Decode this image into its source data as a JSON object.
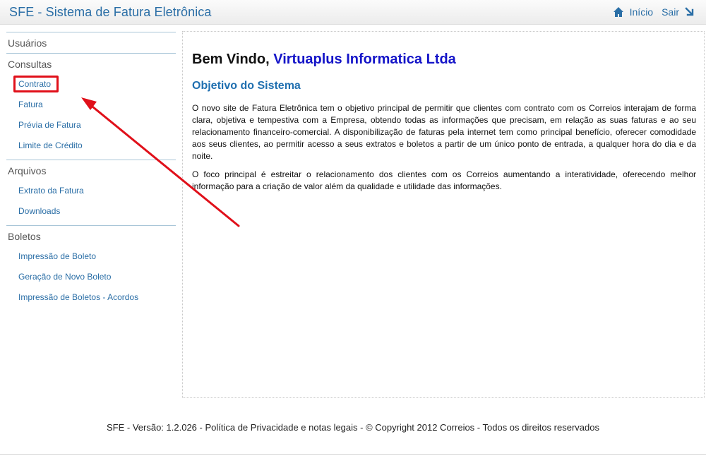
{
  "header": {
    "title": "SFE - Sistema de Fatura Eletrônica",
    "home_label": "Início",
    "exit_label": "Sair"
  },
  "sidebar": {
    "groups": [
      {
        "heading": "Usuários",
        "items": []
      },
      {
        "heading": "Consultas",
        "items": [
          {
            "label": "Contrato",
            "highlighted": true
          },
          {
            "label": "Fatura"
          },
          {
            "label": "Prévia de Fatura"
          },
          {
            "label": "Limite de Crédito"
          }
        ]
      },
      {
        "heading": "Arquivos",
        "items": [
          {
            "label": "Extrato da Fatura"
          },
          {
            "label": "Downloads"
          }
        ]
      },
      {
        "heading": "Boletos",
        "items": [
          {
            "label": "Impressão de Boleto"
          },
          {
            "label": "Geração de Novo Boleto"
          },
          {
            "label": "Impressão de Boletos - Acordos"
          }
        ]
      }
    ]
  },
  "main": {
    "welcome_prefix": "Bem Vindo,",
    "company_name": "Virtuaplus Informatica Ltda",
    "objective_title": "Objetivo do Sistema",
    "paragraph1": "O novo site de Fatura Eletrônica tem o objetivo principal de permitir que clientes com contrato com os Correios interajam de forma clara, objetiva e tempestiva com a Empresa, obtendo todas as informações que precisam, em relação as suas faturas e ao seu relacionamento financeiro-comercial. A disponibilização de faturas pela internet tem como principal benefício, oferecer comodidade aos seus clientes, ao permitir acesso a seus extratos e boletos a partir de um único ponto de entrada, a qualquer hora do dia e da noite.",
    "paragraph2": "O foco principal é estreitar o relacionamento dos clientes com os Correios aumentando a interatividade, oferecendo melhor informação para a criação de valor além da qualidade e utilidade das informações."
  },
  "footer": {
    "text": "SFE - Versão: 1.2.026 - Política de Privacidade e notas legais - © Copyright 2012 Correios - Todos os direitos reservados"
  },
  "colors": {
    "link": "#2a6ea6",
    "company": "#1414c8",
    "annotation": "#e0101a"
  },
  "icons": {
    "home": "home-icon",
    "exit": "exit-arrow-icon"
  }
}
